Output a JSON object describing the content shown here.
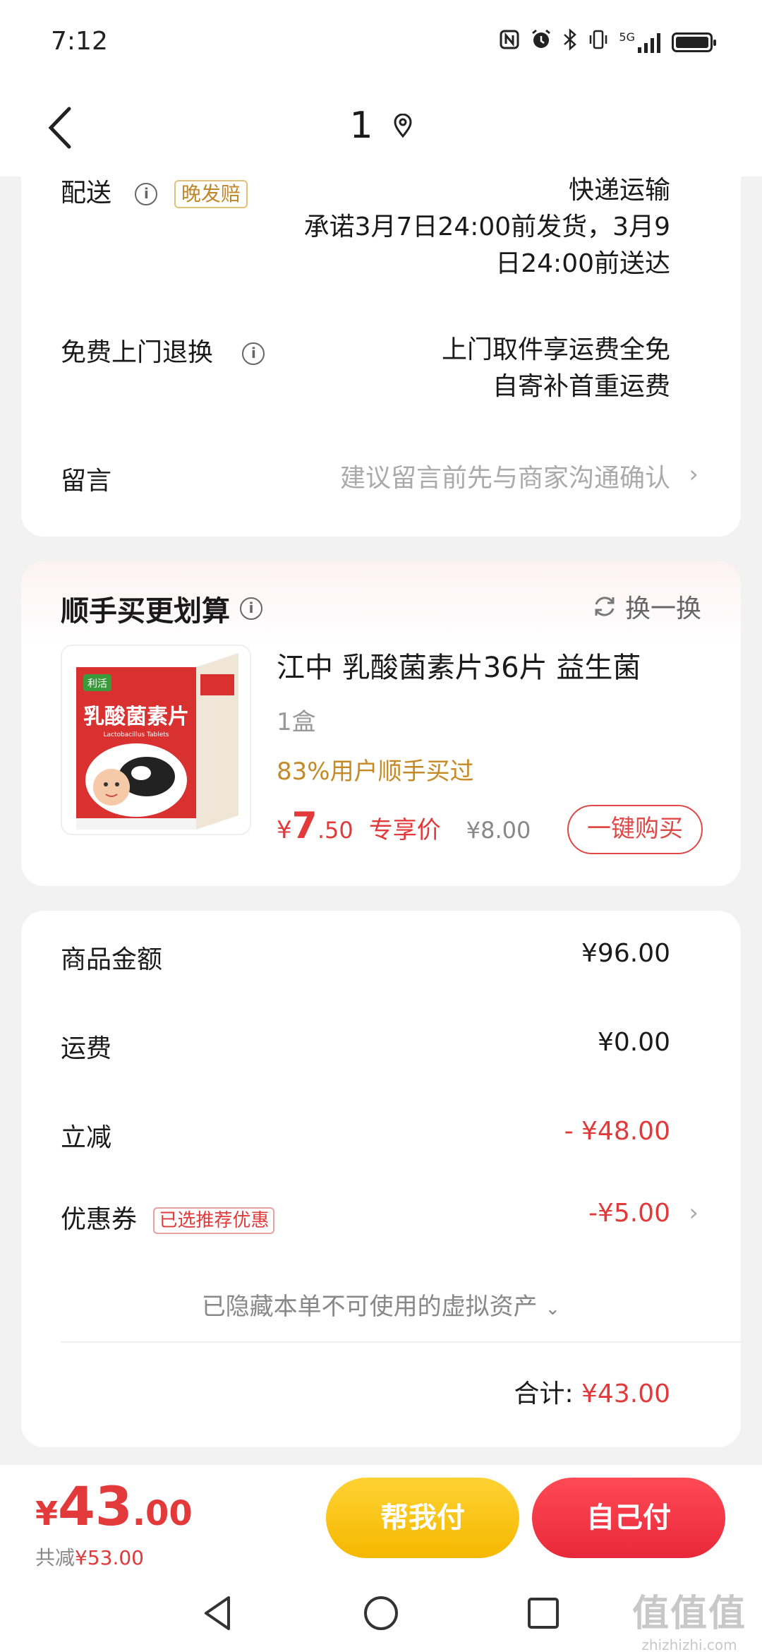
{
  "status_bar": {
    "time": "7:12",
    "network": "5G"
  },
  "header": {
    "title": "1"
  },
  "delivery": {
    "label": "配送",
    "tag": "晚发赔",
    "method": "快递运输",
    "promise_line1": "承诺3月7日24:00前发货，3月9",
    "promise_line2": "日24:00前送达",
    "return_label": "免费上门退换",
    "return_line1": "上门取件享运费全免",
    "return_line2": "自寄补首重运费",
    "note_label": "留言",
    "note_placeholder": "建议留言前先与商家沟通确认"
  },
  "upsell": {
    "title": "顺手买更划算",
    "swap_label": "换一换",
    "product": {
      "name": "江中 乳酸菌素片36片 益生菌",
      "quantity": "1盒",
      "social_proof": "83%用户顺手买过",
      "price_symbol": "¥",
      "price_int": "7",
      "price_dec": ".50",
      "price_label": "专享价",
      "original_price": "¥8.00",
      "buy_button": "一键购买",
      "image_brand": "利活",
      "image_name": "乳酸菌素片",
      "image_subtitle": "Lactobacillus Tablets"
    }
  },
  "summary": {
    "goods_label": "商品金额",
    "goods_value": "¥96.00",
    "shipping_label": "运费",
    "shipping_value": "¥0.00",
    "discount_label": "立减",
    "discount_value": "- ¥48.00",
    "coupon_label": "优惠券",
    "coupon_tag": "已选推荐优惠",
    "coupon_value": "-¥5.00",
    "hidden_assets": "已隐藏本单不可使用的虚拟资产",
    "total_label": "合计:",
    "total_value": "¥43.00"
  },
  "bottom_bar": {
    "pay_symbol": "¥",
    "pay_int": "43",
    "pay_dec": ".00",
    "discount_prefix": "共减",
    "discount_value": "¥53.00",
    "help_pay_button": "帮我付",
    "self_pay_button": "自己付"
  },
  "watermark": {
    "logo": "值值值",
    "url": "zhizhizhi.com"
  },
  "colors": {
    "accent_red": "#e23a3a",
    "accent_yellow": "#f5b800",
    "tag_gold": "#c0862a"
  }
}
